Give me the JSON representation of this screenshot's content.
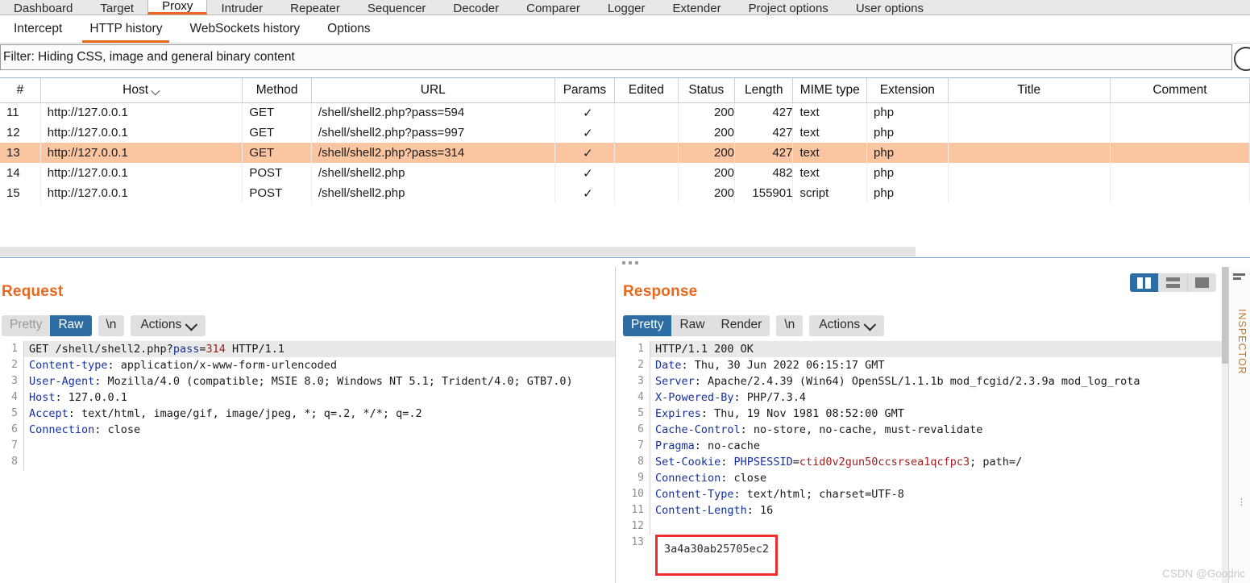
{
  "suite_tabs": [
    {
      "label": "Dashboard",
      "active": false
    },
    {
      "label": "Target",
      "active": false
    },
    {
      "label": "Proxy",
      "active": true
    },
    {
      "label": "Intruder",
      "active": false
    },
    {
      "label": "Repeater",
      "active": false
    },
    {
      "label": "Sequencer",
      "active": false
    },
    {
      "label": "Decoder",
      "active": false
    },
    {
      "label": "Comparer",
      "active": false
    },
    {
      "label": "Logger",
      "active": false
    },
    {
      "label": "Extender",
      "active": false
    },
    {
      "label": "Project options",
      "active": false
    },
    {
      "label": "User options",
      "active": false
    }
  ],
  "sub_tabs": [
    {
      "label": "Intercept",
      "active": false
    },
    {
      "label": "HTTP history",
      "active": true
    },
    {
      "label": "WebSockets history",
      "active": false
    },
    {
      "label": "Options",
      "active": false
    }
  ],
  "filter": {
    "text": "Filter: Hiding CSS, image and general binary content"
  },
  "table": {
    "columns": [
      "#",
      "Host",
      "Method",
      "URL",
      "Params",
      "Edited",
      "Status",
      "Length",
      "MIME type",
      "Extension",
      "Title",
      "Comment"
    ],
    "sorted_column": "Host",
    "rows": [
      {
        "num": "11",
        "host": "http://127.0.0.1",
        "method": "GET",
        "url": "/shell/shell2.php?pass=594",
        "params": "✓",
        "edited": "",
        "status": "200",
        "length": "427",
        "mime": "text",
        "extension": "php",
        "title": "",
        "comment": "",
        "selected": false
      },
      {
        "num": "12",
        "host": "http://127.0.0.1",
        "method": "GET",
        "url": "/shell/shell2.php?pass=997",
        "params": "✓",
        "edited": "",
        "status": "200",
        "length": "427",
        "mime": "text",
        "extension": "php",
        "title": "",
        "comment": "",
        "selected": false
      },
      {
        "num": "13",
        "host": "http://127.0.0.1",
        "method": "GET",
        "url": "/shell/shell2.php?pass=314",
        "params": "✓",
        "edited": "",
        "status": "200",
        "length": "427",
        "mime": "text",
        "extension": "php",
        "title": "",
        "comment": "",
        "selected": true
      },
      {
        "num": "14",
        "host": "http://127.0.0.1",
        "method": "POST",
        "url": "/shell/shell2.php",
        "params": "✓",
        "edited": "",
        "status": "200",
        "length": "482",
        "mime": "text",
        "extension": "php",
        "title": "",
        "comment": "",
        "selected": false
      },
      {
        "num": "15",
        "host": "http://127.0.0.1",
        "method": "POST",
        "url": "/shell/shell2.php",
        "params": "✓",
        "edited": "",
        "status": "200",
        "length": "155901",
        "mime": "script",
        "extension": "php",
        "title": "",
        "comment": "",
        "selected": false
      }
    ]
  },
  "request": {
    "title": "Request",
    "view_modes": [
      {
        "label": "Pretty",
        "state": "disabled"
      },
      {
        "label": "Raw",
        "state": "active"
      }
    ],
    "newline_label": "\\n",
    "actions_label": "Actions",
    "lines": [
      {
        "n": "1",
        "segments": [
          {
            "t": "GET /shell/shell2.php?",
            "c": "plain"
          },
          {
            "t": "pass",
            "c": "param-blue"
          },
          {
            "t": "=",
            "c": "plain"
          },
          {
            "t": "314",
            "c": "param-red"
          },
          {
            "t": " HTTP/1.1",
            "c": "plain"
          }
        ],
        "first": true
      },
      {
        "n": "2",
        "segments": [
          {
            "t": "Content-type",
            "c": "hdr"
          },
          {
            "t": ": application/x-www-form-urlencoded",
            "c": "plain"
          }
        ]
      },
      {
        "n": "3",
        "segments": [
          {
            "t": "User-Agent",
            "c": "hdr"
          },
          {
            "t": ": Mozilla/4.0 (compatible; MSIE 8.0; Windows NT 5.1; Trident/4.0; GTB7.0)",
            "c": "plain"
          }
        ]
      },
      {
        "n": "4",
        "segments": [
          {
            "t": "Host",
            "c": "hdr"
          },
          {
            "t": ": 127.0.0.1",
            "c": "plain"
          }
        ]
      },
      {
        "n": "5",
        "segments": [
          {
            "t": "Accept",
            "c": "hdr"
          },
          {
            "t": ": text/html, image/gif, image/jpeg, *; q=.2, */*; q=.2",
            "c": "plain"
          }
        ]
      },
      {
        "n": "6",
        "segments": [
          {
            "t": "Connection",
            "c": "hdr"
          },
          {
            "t": ": close",
            "c": "plain"
          }
        ]
      },
      {
        "n": "7",
        "segments": [
          {
            "t": "",
            "c": "plain"
          }
        ]
      },
      {
        "n": "8",
        "segments": [
          {
            "t": "",
            "c": "plain"
          }
        ]
      }
    ]
  },
  "response": {
    "title": "Response",
    "view_modes": [
      {
        "label": "Pretty",
        "state": "active"
      },
      {
        "label": "Raw",
        "state": "normal"
      },
      {
        "label": "Render",
        "state": "normal"
      }
    ],
    "newline_label": "\\n",
    "actions_label": "Actions",
    "layout_toggles": [
      {
        "name": "split-vertical",
        "active": true
      },
      {
        "name": "split-horizontal",
        "active": false
      },
      {
        "name": "single-pane",
        "active": false
      }
    ],
    "lines": [
      {
        "n": "1",
        "segments": [
          {
            "t": "HTTP/1.1 200 OK",
            "c": "plain"
          }
        ],
        "first": true
      },
      {
        "n": "2",
        "segments": [
          {
            "t": "Date",
            "c": "hdr"
          },
          {
            "t": ": Thu, 30 Jun 2022 06:15:17 GMT",
            "c": "plain"
          }
        ]
      },
      {
        "n": "3",
        "segments": [
          {
            "t": "Server",
            "c": "hdr"
          },
          {
            "t": ": Apache/2.4.39 (Win64) OpenSSL/1.1.1b mod_fcgid/2.3.9a mod_log_rota",
            "c": "plain"
          }
        ]
      },
      {
        "n": "4",
        "segments": [
          {
            "t": "X-Powered-By",
            "c": "hdr"
          },
          {
            "t": ": PHP/7.3.4",
            "c": "plain"
          }
        ]
      },
      {
        "n": "5",
        "segments": [
          {
            "t": "Expires",
            "c": "hdr"
          },
          {
            "t": ": Thu, 19 Nov 1981 08:52:00 GMT",
            "c": "plain"
          }
        ]
      },
      {
        "n": "6",
        "segments": [
          {
            "t": "Cache-Control",
            "c": "hdr"
          },
          {
            "t": ": no-store, no-cache, must-revalidate",
            "c": "plain"
          }
        ]
      },
      {
        "n": "7",
        "segments": [
          {
            "t": "Pragma",
            "c": "hdr"
          },
          {
            "t": ": no-cache",
            "c": "plain"
          }
        ]
      },
      {
        "n": "8",
        "segments": [
          {
            "t": "Set-Cookie",
            "c": "hdr"
          },
          {
            "t": ": ",
            "c": "plain"
          },
          {
            "t": "PHPSESSID",
            "c": "param-blue"
          },
          {
            "t": "=",
            "c": "plain"
          },
          {
            "t": "ctid0v2gun50ccsrsea1qcfpc3",
            "c": "param-red"
          },
          {
            "t": "; path=/",
            "c": "plain"
          }
        ]
      },
      {
        "n": "9",
        "segments": [
          {
            "t": "Connection",
            "c": "hdr"
          },
          {
            "t": ": close",
            "c": "plain"
          }
        ]
      },
      {
        "n": "10",
        "segments": [
          {
            "t": "Content-Type",
            "c": "hdr"
          },
          {
            "t": ": text/html; charset=UTF-8",
            "c": "plain"
          }
        ]
      },
      {
        "n": "11",
        "segments": [
          {
            "t": "Content-Length",
            "c": "hdr"
          },
          {
            "t": ": 16",
            "c": "plain"
          }
        ]
      },
      {
        "n": "12",
        "segments": [
          {
            "t": "",
            "c": "plain"
          }
        ]
      }
    ],
    "body_line_number": "13",
    "body_text": "3a4a30ab25705ec2",
    "body_highlight_color": "#ef2b2b"
  },
  "inspector": {
    "label": "INSPECTOR"
  },
  "watermark": "CSDN @Goodric",
  "colors": {
    "accent_orange": "#e8681d",
    "selected_row": "#fac5a0",
    "active_blue": "#2e6da4"
  }
}
